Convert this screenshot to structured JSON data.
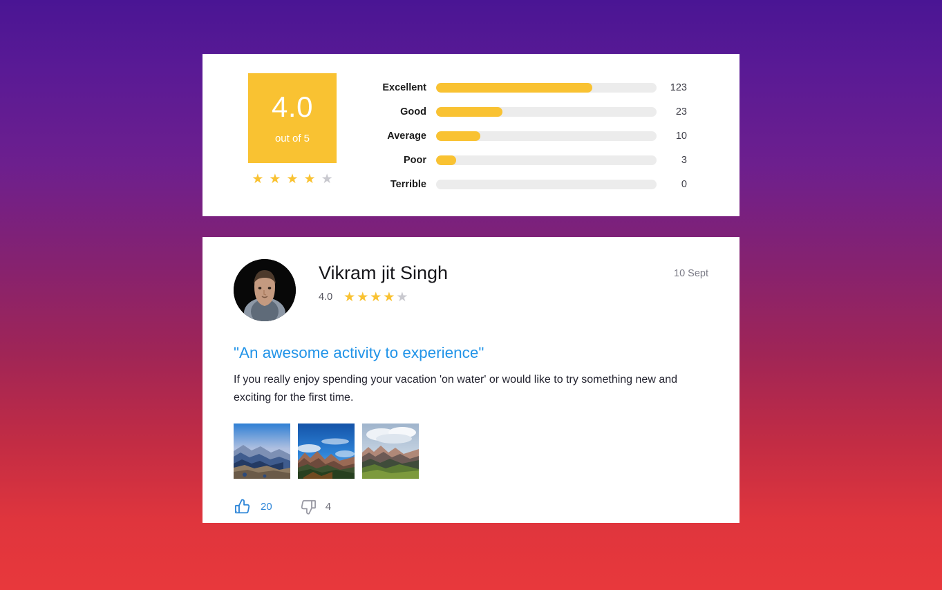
{
  "theme": {
    "gradient_top": "#4a1594",
    "gradient_bottom": "#e8383c",
    "accent_yellow": "#f9c232",
    "accent_blue": "#2294e8",
    "track_gray": "#ececec",
    "star_off": "#c9c9cf"
  },
  "summary": {
    "score": "4.0",
    "out_of_label": "out of 5",
    "stars_filled": 4,
    "stars_total": 5,
    "star_glyph": "★",
    "breakdown": [
      {
        "label": "Excellent",
        "count": "123",
        "percent": 71
      },
      {
        "label": "Good",
        "count": "23",
        "percent": 30
      },
      {
        "label": "Average",
        "count": "10",
        "percent": 20
      },
      {
        "label": "Poor",
        "count": "3",
        "percent": 9
      },
      {
        "label": "Terrible",
        "count": "0",
        "percent": 0
      }
    ]
  },
  "review": {
    "author": "Vikram jit Singh",
    "avatar_icon": "user-avatar-photo",
    "rating_value": "4.0",
    "stars_filled": 4,
    "stars_total": 5,
    "star_glyph": "★",
    "date": "10 Sept",
    "title": "\"An awesome activity to experience\"",
    "body": "If you really enjoy spending your vacation 'on water' or would like to try something new and exciting for the first time.",
    "photos": [
      {
        "alt": "misty blue mountain range landscape"
      },
      {
        "alt": "rocky peaks under deep blue sky"
      },
      {
        "alt": "green meadow with cloudy mountain peaks"
      }
    ],
    "reactions": {
      "like_icon": "thumbs-up-icon",
      "like_count": "20",
      "dislike_icon": "thumbs-down-icon",
      "dislike_count": "4"
    }
  }
}
